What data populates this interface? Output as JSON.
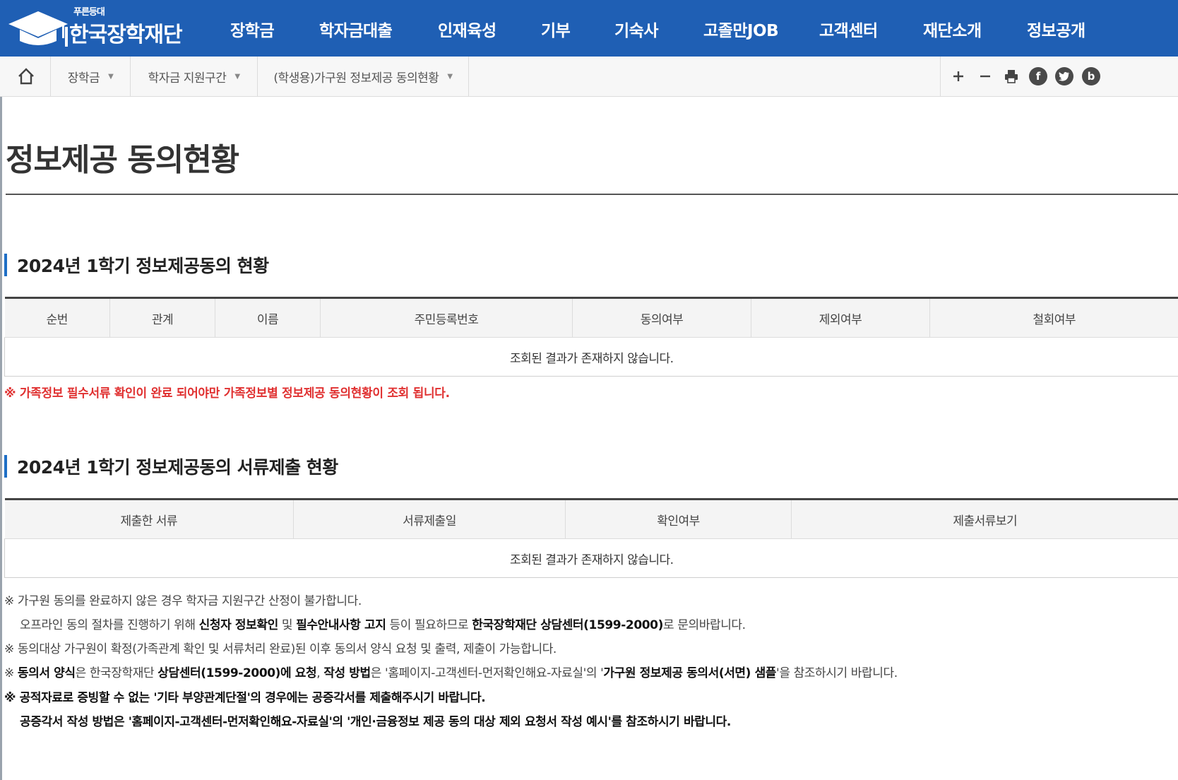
{
  "header": {
    "logo_small": "푸른등대",
    "logo_text": "한국장학재단",
    "nav": [
      "장학금",
      "학자금대출",
      "인재육성",
      "기부",
      "기숙사",
      "고졸만JOB",
      "고객센터",
      "재단소개",
      "정보공개"
    ],
    "bg_color": "#1f5fb4"
  },
  "breadcrumb": {
    "items": [
      "장학금",
      "학자금 지원구간",
      "(학생용)가구원 정보제공 동의현황"
    ],
    "tools": [
      "zoom-in-icon",
      "zoom-out-icon",
      "print-icon",
      "facebook-icon",
      "twitter-icon",
      "blog-icon"
    ],
    "facebook": "f",
    "blog": "b"
  },
  "page": {
    "title": "정보제공 동의현황"
  },
  "section1": {
    "heading": "2024년 1학기 정보제공동의 현황",
    "columns": [
      "순번",
      "관계",
      "이름",
      "주민등록번호",
      "동의여부",
      "제외여부",
      "철회여부"
    ],
    "empty": "조회된 결과가 존재하지 않습니다.",
    "notice": "※ 가족정보 필수서류 확인이 완료 되어야만 가족정보별 정보제공 동의현황이 조회 됩니다."
  },
  "section2": {
    "heading": "2024년 1학기 정보제공동의 서류제출 현황",
    "columns": [
      "제출한 서류",
      "서류제출일",
      "확인여부",
      "제출서류보기"
    ],
    "empty": "조회된 결과가 존재하지 않습니다."
  },
  "notes": {
    "n1": "※ 가구원 동의를 완료하지 않은 경우 학자금 지원구간 산정이 불가합니다.",
    "n2_a": "오프라인 동의 절차를 진행하기 위해 ",
    "n2_b": "신청자 정보확인",
    "n2_c": " 및 ",
    "n2_d": "필수안내사항 고지",
    "n2_e": " 등이 필요하므로 ",
    "n2_f": "한국장학재단 상담센터(1599-2000)",
    "n2_g": "로 문의바랍니다.",
    "n3": "※ 동의대상 가구원이 확정(가족관계 확인 및 서류처리 완료)된 이후 동의서 양식 요청 및 출력, 제출이 가능합니다.",
    "n4_a": "※ ",
    "n4_b": "동의서 양식",
    "n4_c": "은 한국장학재단 ",
    "n4_d": "상담센터(1599-2000)에 요청",
    "n4_e": ", ",
    "n4_f": "작성 방법",
    "n4_g": "은 '홈페이지-고객센터-먼저확인해요-자료실'의 '",
    "n4_h": "가구원 정보제공 동의서(서면) 샘플",
    "n4_i": "'을 참조하시기 바랍니다.",
    "n5": "※ 공적자료로 증빙할 수 없는 '기타 부양관계단절'의 경우에는 공증각서를 제출해주시기 바랍니다.",
    "n6": "공증각서 작성 방법은 '홈페이지-고객센터-먼저확인해요-자료실'의 '개인·금융정보 제공 동의 대상 제외 요청서 작성 예시'를 참조하시기 바랍니다."
  }
}
